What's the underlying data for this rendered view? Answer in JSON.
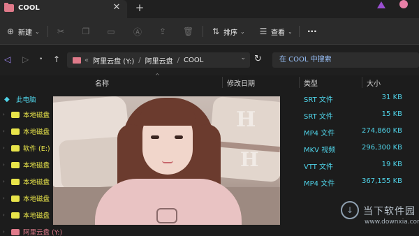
{
  "window": {
    "tab_title": "COOL",
    "tab_close": "✕",
    "new_tab": "+"
  },
  "toolbar": {
    "new_label": "新建",
    "sort_label": "排序",
    "view_label": "查看",
    "more": "···",
    "chevron": "⌄"
  },
  "address": {
    "back": "◁",
    "forward": "▷",
    "dot": "•",
    "up": "↑",
    "prefix": "«",
    "segments": [
      "阿里云盘 (Y:)",
      "阿里云盘",
      "COOL"
    ],
    "separator": "/",
    "chevron": "⌄",
    "refresh": "↻",
    "search_placeholder": "在 COOL 中搜索"
  },
  "columns": {
    "name": "名称",
    "modified": "修改日期",
    "type": "类型",
    "size": "大小",
    "sort_glyph": "^"
  },
  "sidebar": {
    "items": [
      {
        "label": "此电脑",
        "style": "cyan",
        "icon": "gem-icon"
      },
      {
        "label": "本地磁盘",
        "style": "yellow",
        "icon": "drive-icon"
      },
      {
        "label": "本地磁盘",
        "style": "yellow",
        "icon": "drive-icon"
      },
      {
        "label": "软件 (E:)",
        "style": "yellow",
        "icon": "drive-icon"
      },
      {
        "label": "本地磁盘",
        "style": "yellow",
        "icon": "drive-icon"
      },
      {
        "label": "本地磁盘",
        "style": "yellow",
        "icon": "drive-icon"
      },
      {
        "label": "本地磁盘",
        "style": "yellow",
        "icon": "drive-icon"
      },
      {
        "label": "本地磁盘",
        "style": "yellow",
        "icon": "drive-icon"
      },
      {
        "label": "阿里云盘 (Y:)",
        "style": "pink",
        "icon": "cloud-drive-icon"
      }
    ],
    "expand_glyph": "›"
  },
  "files": [
    {
      "type": "SRT 文件",
      "size": "31 KB"
    },
    {
      "type": "SRT 文件",
      "size": "15 KB"
    },
    {
      "type": "MP4 文件",
      "size": "274,860 KB"
    },
    {
      "type": "MKV 视频",
      "size": "296,300 KB"
    },
    {
      "type": "VTT 文件",
      "size": "19 KB"
    },
    {
      "type": "MP4 文件",
      "size": "367,155 KB"
    }
  ],
  "watermark": {
    "title": "当下软件园",
    "url": "www.downxia.com",
    "logo_glyph": "↓"
  },
  "colors": {
    "accent_cyan": "#4fd3e8",
    "accent_yellow": "#e8e44a",
    "accent_pink": "#e07a8a",
    "search_text": "#9cc5ff"
  }
}
